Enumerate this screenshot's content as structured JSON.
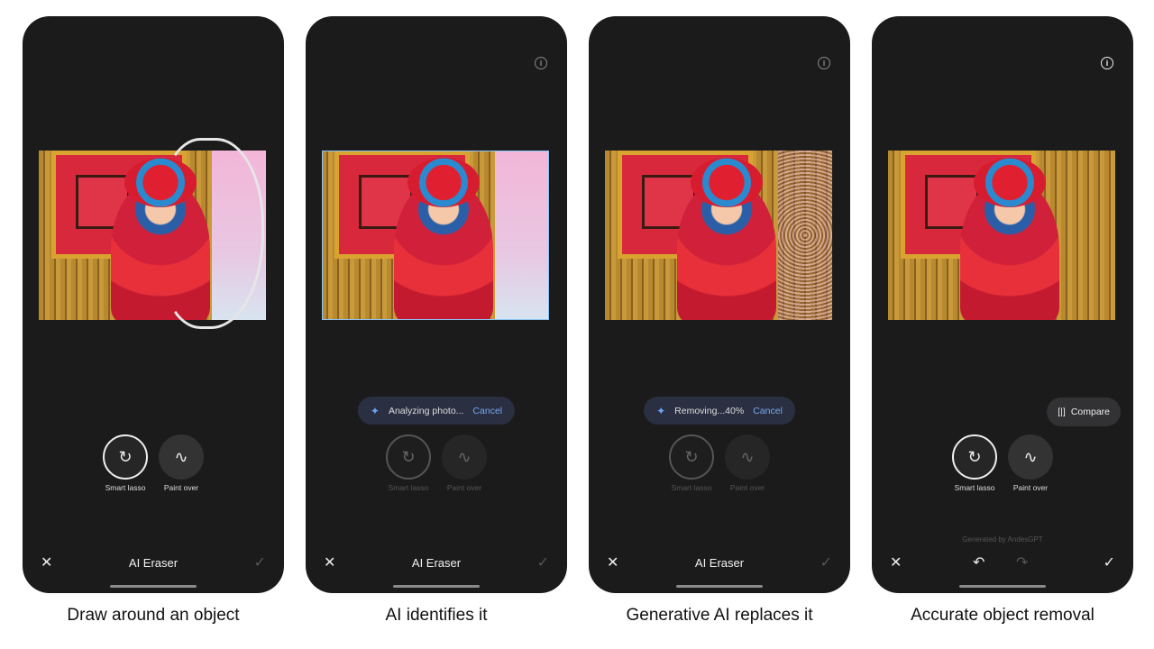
{
  "panels": [
    {
      "caption": "Draw around an object",
      "title": "AI Eraser",
      "state": "lasso",
      "tools": [
        {
          "label": "Smart lasso",
          "icon": "smart-lasso-icon",
          "active": true
        },
        {
          "label": "Paint over",
          "icon": "paint-over-icon",
          "active": false
        }
      ]
    },
    {
      "caption": "AI identifies it",
      "title": "AI Eraser",
      "state": "analyzing",
      "status": "Analyzing photo...",
      "cancel": "Cancel",
      "tools": [
        {
          "label": "Smart lasso",
          "icon": "smart-lasso-icon",
          "active": true
        },
        {
          "label": "Paint over",
          "icon": "paint-over-icon",
          "active": false
        }
      ]
    },
    {
      "caption": "Generative AI replaces it",
      "title": "AI Eraser",
      "state": "removing",
      "status": "Removing...40%",
      "progress_percent": 40,
      "cancel": "Cancel",
      "tools": [
        {
          "label": "Smart lasso",
          "icon": "smart-lasso-icon",
          "active": true
        },
        {
          "label": "Paint over",
          "icon": "paint-over-icon",
          "active": false
        }
      ]
    },
    {
      "caption": "Accurate object removal",
      "title": "",
      "state": "done",
      "compare": "Compare",
      "generated": "Generated by AndesGPT",
      "tools": [
        {
          "label": "Smart lasso",
          "icon": "smart-lasso-icon",
          "active": true
        },
        {
          "label": "Paint over",
          "icon": "paint-over-icon",
          "active": false
        }
      ]
    }
  ],
  "colors": {
    "phone_bg": "#1b1b1c",
    "accent": "#79a8f2",
    "status_pill": "#2a2f42"
  }
}
